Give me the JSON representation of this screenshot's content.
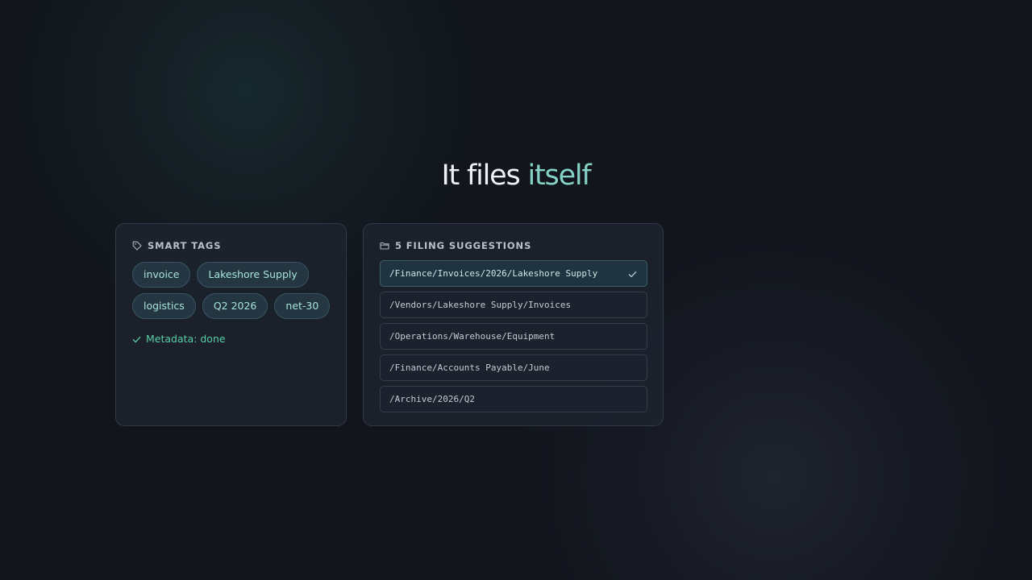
{
  "headline": {
    "prefix": "It files",
    "accent": "itself"
  },
  "smart_tags": {
    "header": "SMART TAGS",
    "icon": "tag-icon",
    "tags": [
      "invoice",
      "Lakeshore Supply",
      "logistics",
      "Q2 2026",
      "net-30"
    ],
    "status_icon": "check-icon",
    "status": "Metadata: done"
  },
  "filing": {
    "header": "5 FILING SUGGESTIONS",
    "icon": "folder-icon",
    "suggestions": [
      {
        "path": "/Finance/Invoices/2026/Lakeshore Supply",
        "selected": true
      },
      {
        "path": "/Vendors/Lakeshore Supply/Invoices",
        "selected": false
      },
      {
        "path": "/Operations/Warehouse/Equipment",
        "selected": false
      },
      {
        "path": "/Finance/Accounts Payable/June",
        "selected": false
      },
      {
        "path": "/Archive/2026/Q2",
        "selected": false
      }
    ],
    "selected_icon": "check-icon"
  },
  "colors": {
    "background": "#12151c",
    "accent": "#84d3c6",
    "tag_text": "#a6e3d8",
    "success": "#59cfa5"
  }
}
